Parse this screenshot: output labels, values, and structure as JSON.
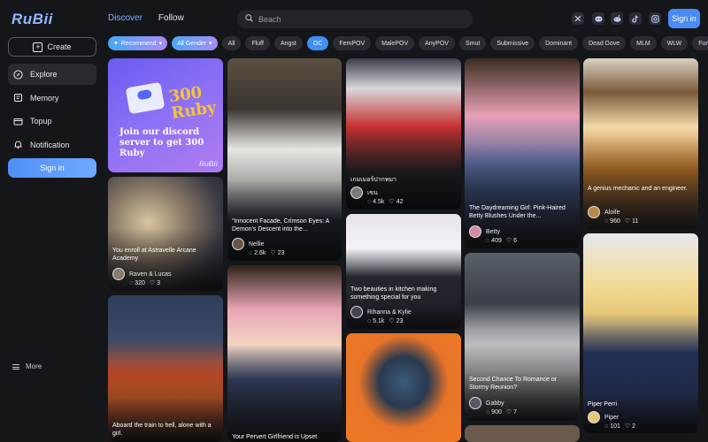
{
  "app": {
    "logo": "RuBii"
  },
  "sidebar": {
    "create_label": "Create",
    "items": [
      {
        "label": "Explore",
        "icon": "compass-icon"
      },
      {
        "label": "Memory",
        "icon": "memory-icon"
      },
      {
        "label": "Topup",
        "icon": "wallet-icon"
      },
      {
        "label": "Notification",
        "icon": "bell-icon"
      }
    ],
    "signin_label": "Sign in",
    "more_label": "More"
  },
  "header": {
    "tabs": [
      {
        "label": "Discover"
      },
      {
        "label": "Follow"
      }
    ],
    "search_placeholder": "Beach",
    "social_icons": [
      "x-icon",
      "discord-icon",
      "reddit-icon",
      "tiktok-icon",
      "instagram-icon"
    ],
    "signin_label": "Sign in"
  },
  "filters": {
    "dropdowns": [
      {
        "label": "Recommend"
      },
      {
        "label": "All Gender"
      }
    ],
    "chips": [
      "All",
      "Fluff",
      "Angst",
      "OC",
      "FemPOV",
      "MalePOV",
      "AnyPOV",
      "Smut",
      "Submissive",
      "Dominant",
      "Dead Dove",
      "MLM",
      "WLW",
      "Furry"
    ],
    "active_chip": "OC"
  },
  "promo": {
    "title": "Join our discord server to get 300 Ruby",
    "badge": "300 Ruby",
    "brand": "RuBii",
    "pass_label": "discord"
  },
  "cards": [
    {
      "title": "You enroll at Astravelle Arcane Academy",
      "author": "Raven & Lucas",
      "comments": "320",
      "likes": "3"
    },
    {
      "title": "Aboard the train to hell, alone with a girl.",
      "author": "",
      "comments": "",
      "likes": ""
    },
    {
      "title": "\"Innocent Facade, Crimson Eyes: A Demon's Descent into the...",
      "author": "Nellie",
      "comments": "2.6k",
      "likes": "23"
    },
    {
      "title": "Your Pervert Girlfriend is Upset",
      "author": "",
      "comments": "",
      "likes": ""
    },
    {
      "title": "เกมเมอร์ปากหมา",
      "author": "เซน",
      "comments": "4.5k",
      "likes": "42"
    },
    {
      "title": "Two beauties in kitchen making something special for you",
      "author": "Rihanna & Kylie",
      "comments": "5.1k",
      "likes": "23"
    },
    {
      "title": "The Daydreaming Girl: Pink-Haired Betty Blushes Under the...",
      "author": "Betty",
      "comments": "409",
      "likes": "6"
    },
    {
      "title": "Second Chance To Romance or Stormy Reunion?",
      "author": "Gabby",
      "comments": "900",
      "likes": "7"
    },
    {
      "title": "A genius mechanic and an engineer.",
      "author": "Aloife",
      "comments": "960",
      "likes": "11"
    },
    {
      "title": "Piper Perri",
      "author": "Piper",
      "comments": "101",
      "likes": "2"
    }
  ]
}
